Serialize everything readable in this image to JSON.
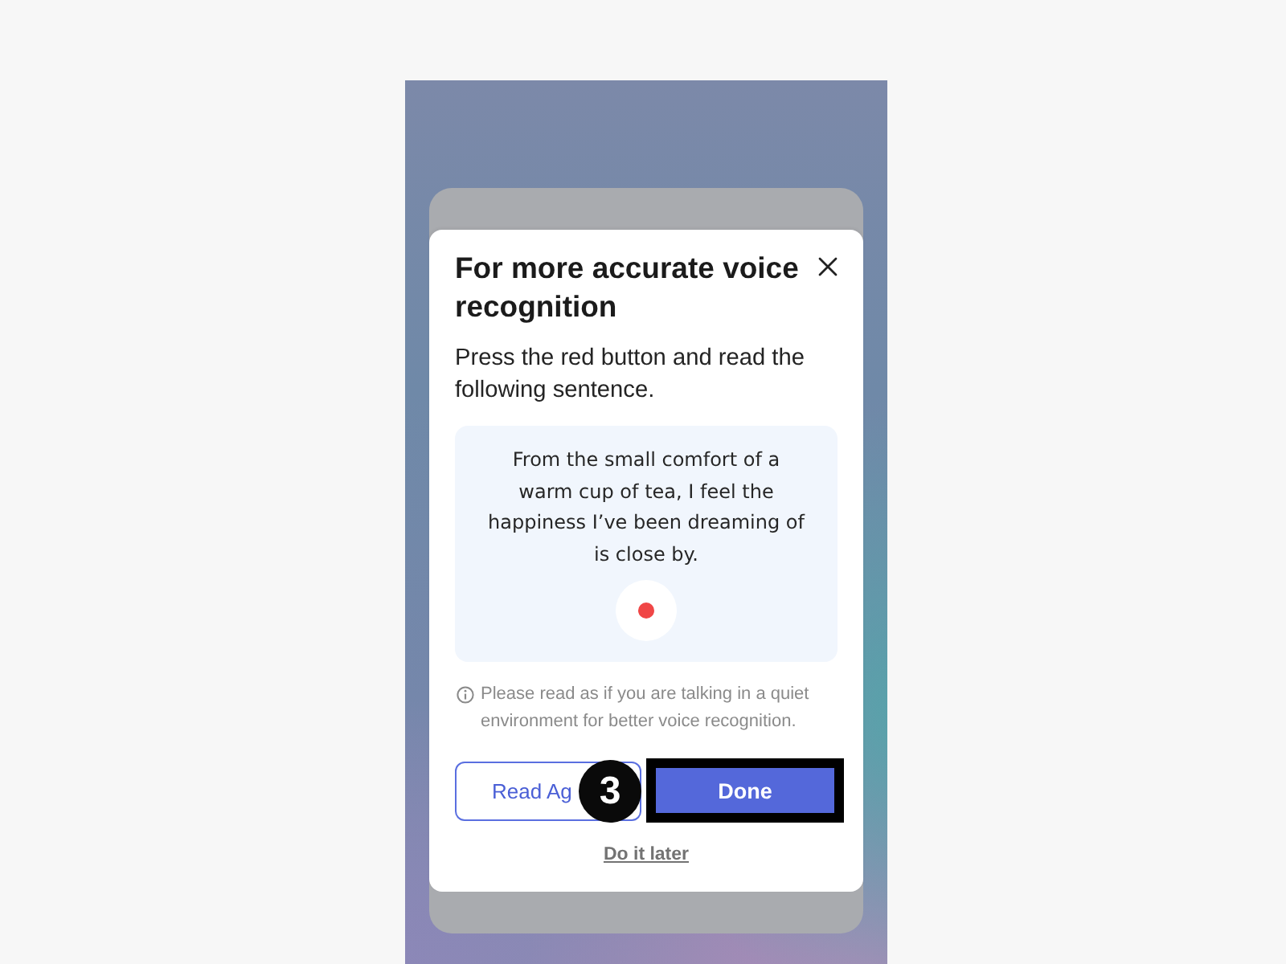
{
  "modal": {
    "title": "For more accurate voice recognition",
    "instruction": "Press the red button and read the following sentence.",
    "sentence": "From the small comfort of a warm cup of tea, I feel the happiness I’ve been dreaming of is close by.",
    "note": "Please read as if you are talking in a quiet environment for better voice recognition.",
    "buttons": [
      {
        "label": "Read Ag",
        "kind": "secondary",
        "highlighted": false
      },
      {
        "label": "Done",
        "kind": "primary",
        "highlighted": true
      }
    ],
    "later_link": "Do it later"
  },
  "step_marker": {
    "label": "3"
  }
}
